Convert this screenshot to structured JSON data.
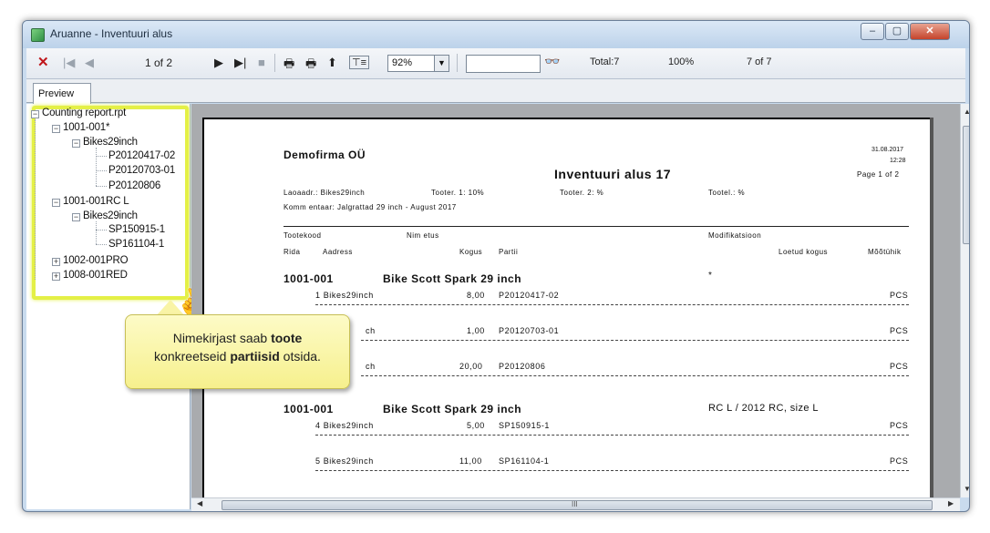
{
  "window": {
    "title": "Aruanne - Inventuuri alus"
  },
  "toolbar": {
    "page_indicator": "1 of 2",
    "zoom": "92%",
    "search_value": "",
    "total": "Total:7",
    "percent": "100%",
    "records": "7 of 7"
  },
  "tabs": {
    "preview": "Preview"
  },
  "tree": {
    "root": "Counting report.rpt",
    "nodes": [
      "1001-001*",
      "Bikes29inch",
      "P20120417-02",
      "P20120703-01",
      "P20120806",
      "1001-001RC L",
      "Bikes29inch",
      "SP150915-1",
      "SP161104-1",
      "1002-001PRO",
      "1008-001RED"
    ]
  },
  "callout": {
    "line1_pre": "Nimekirjast saab ",
    "line1_bold": "toote",
    "line2_pre": "konkreetseid ",
    "line2_bold": "partiisid",
    "line2_post": " otsida."
  },
  "report": {
    "company": "Demofirma OÜ",
    "title": "Inventuuri alus  17",
    "date": "31.08.2017",
    "time": "12:28",
    "page": "Page 1 of 2",
    "warehouse": "Laoaadr.: Bikes29inch",
    "tooter1": "Tooter. 1: 10%",
    "tooter2": "Tooter. 2: %",
    "tootel": "Tootel.: %",
    "comment": "Komm entaar: Jalgrattad 29 inch - August 2017",
    "headers": {
      "tootekood": "Tootekood",
      "nimetus": "Nim etus",
      "modifikatsioon": "Modifikatsioon",
      "rida": "Rida",
      "aadress": "Aadress",
      "kogus": "Kogus",
      "partii": "Partii",
      "loetud": "Loetud kogus",
      "moot": "Mõõtühik"
    },
    "groups": [
      {
        "code": "1001-001",
        "name": "Bike Scott Spark 29 inch",
        "mod": "*",
        "rows": [
          {
            "addr": "1 Bikes29inch",
            "qty": "8,00",
            "lot": "P20120417-02",
            "unit": "PCS"
          },
          {
            "addr": "ch",
            "qty": "1,00",
            "lot": "P20120703-01",
            "unit": "PCS"
          },
          {
            "addr": "ch",
            "qty": "20,00",
            "lot": "P20120806",
            "unit": "PCS"
          }
        ]
      },
      {
        "code": "1001-001",
        "name": "Bike Scott Spark 29 inch",
        "mod": "RC L / 2012 RC, size L",
        "rows": [
          {
            "addr": "4 Bikes29inch",
            "qty": "5,00",
            "lot": "SP150915-1",
            "unit": "PCS"
          },
          {
            "addr": "5 Bikes29inch",
            "qty": "11,00",
            "lot": "SP161104-1",
            "unit": "PCS"
          }
        ]
      }
    ]
  },
  "hscroll": {
    "grip": "III"
  }
}
